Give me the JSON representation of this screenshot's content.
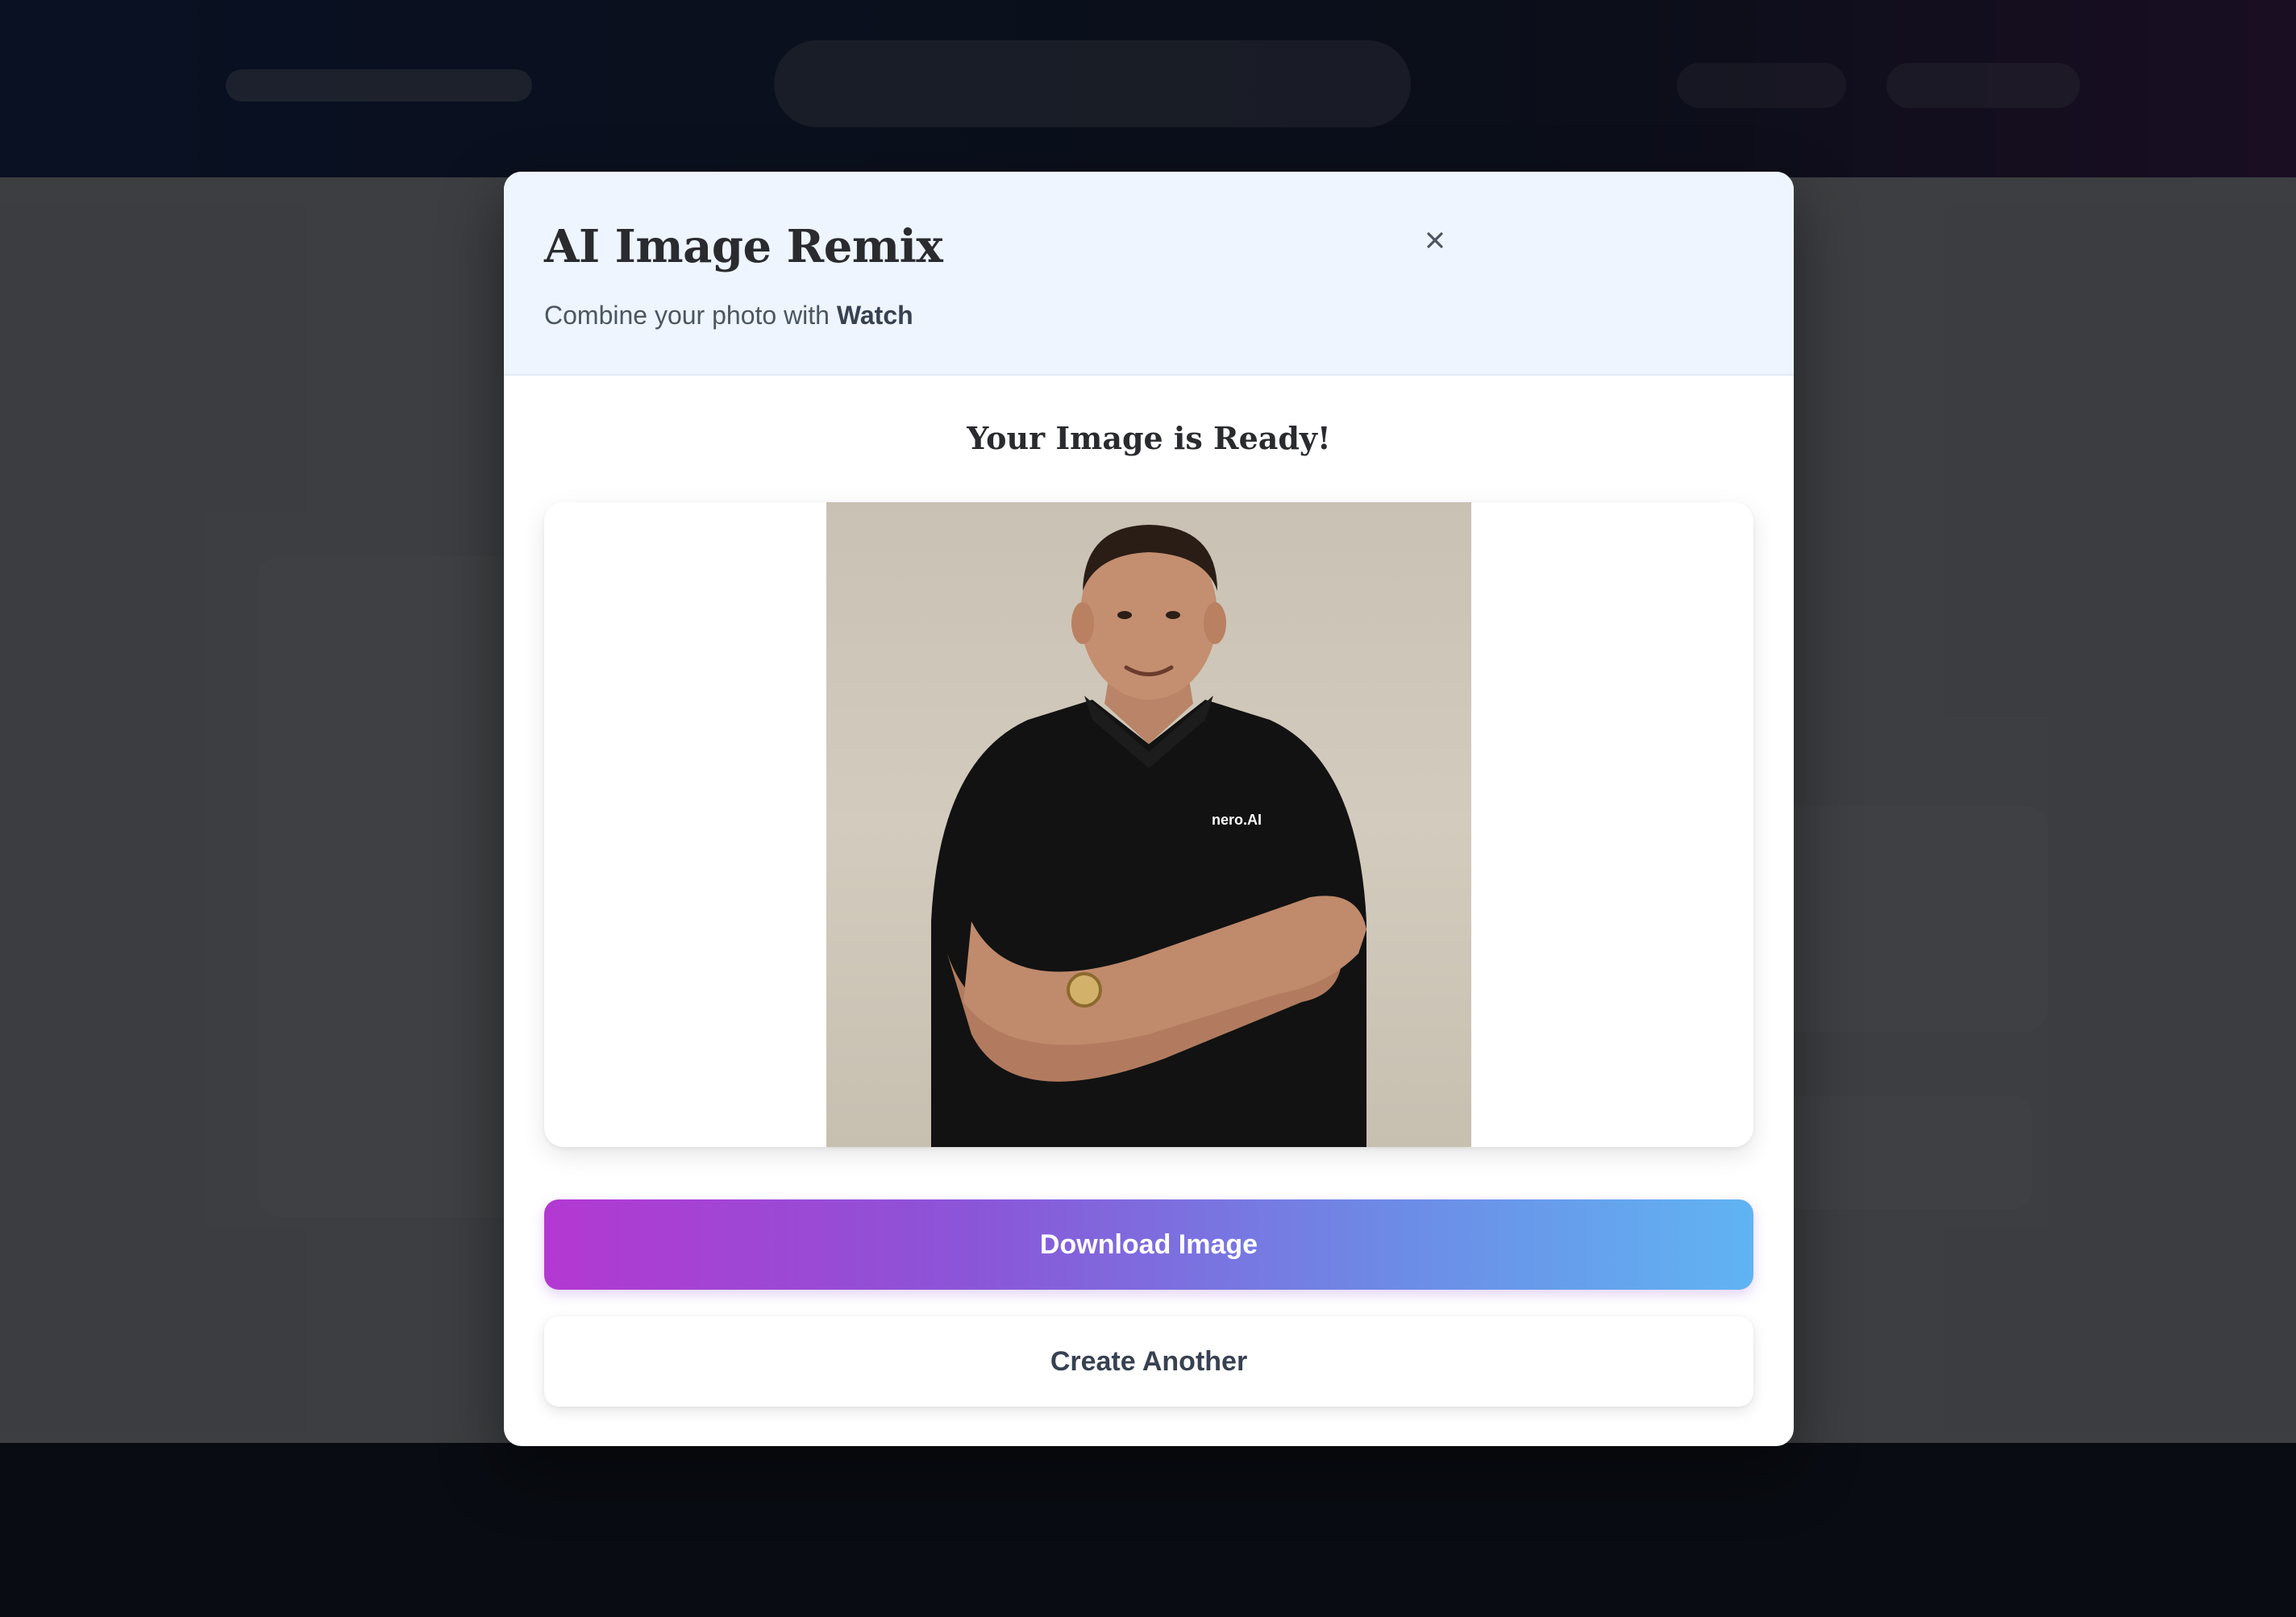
{
  "modal": {
    "title": "AI Image Remix",
    "subtitle_prefix": "Combine your photo with ",
    "subtitle_item": "Watch",
    "close_icon": "close-icon",
    "result_heading": "Your Image is Ready!",
    "image": {
      "description_icon": "result-image",
      "shirt_text": "nero.AI"
    },
    "download_label": "Download Image",
    "create_another_label": "Create Another"
  },
  "colors": {
    "overlay": "#080a0e",
    "header_bg": "#eef5fe",
    "download_gradient_start": "#b338d1",
    "download_gradient_end": "#60b4f2",
    "title_text": "#2a2b2e"
  }
}
